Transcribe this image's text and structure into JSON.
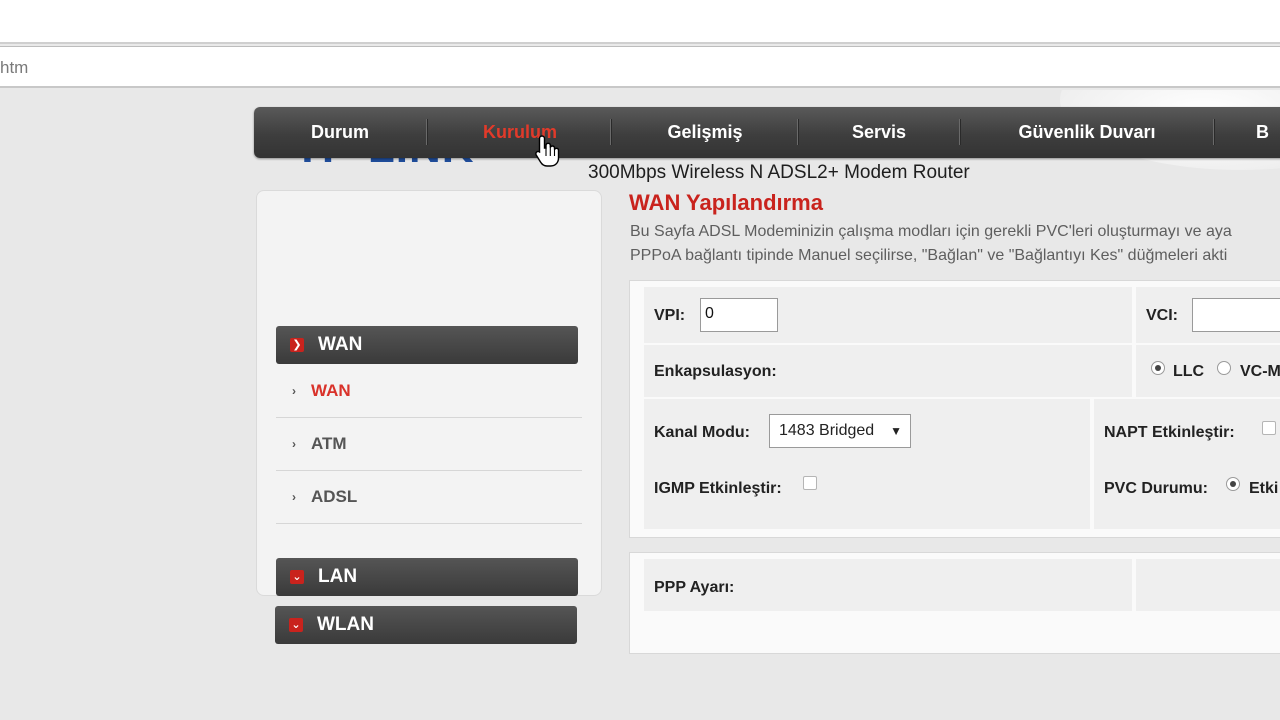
{
  "browser": {
    "address_text": "htm"
  },
  "header": {
    "logo_text": "TP-LINK",
    "logo_reg": "®",
    "product": "300Mbps Wireless N ADSL2+ Modem Router"
  },
  "nav": {
    "items": [
      {
        "label": "Durum"
      },
      {
        "label": "Kurulum"
      },
      {
        "label": "Gelişmiş"
      },
      {
        "label": "Servis"
      },
      {
        "label": "Güvenlik Duvarı"
      },
      {
        "label": "B"
      }
    ],
    "active_color": "#e23a2a"
  },
  "sidebar": {
    "groups": [
      {
        "label": "WAN",
        "arrow": "›"
      },
      {
        "label": "LAN",
        "arrow": "⌄"
      },
      {
        "label": "WLAN",
        "arrow": "⌄"
      }
    ],
    "wan_items": [
      {
        "label": "WAN"
      },
      {
        "label": "ATM"
      },
      {
        "label": "ADSL"
      }
    ]
  },
  "content": {
    "title": "WAN Yapılandırma",
    "desc_line1": "Bu Sayfa ADSL Modeminizin çalışma modları için gerekli PVC'leri oluşturmayı ve aya",
    "desc_line2": "PPPoA bağlantı tipinde Manuel seçilirse, \"Bağlan\" ve \"Bağlantıyı Kes\" düğmeleri akti"
  },
  "form": {
    "vpi_label": "VPI:",
    "vpi_value": "0",
    "vci_label": "VCI:",
    "vci_value": "",
    "encap_label": "Enkapsulasyon:",
    "encap_llc": "LLC",
    "encap_vcm": "VC-M",
    "channel_label": "Kanal Modu:",
    "channel_value": "1483 Bridged",
    "napt_label": "NAPT Etkinleştir:",
    "igmp_label": "IGMP Etkinleştir:",
    "pvc_label": "PVC Durumu:",
    "pvc_value": "Etki",
    "ppp_label": "PPP Ayarı:"
  }
}
